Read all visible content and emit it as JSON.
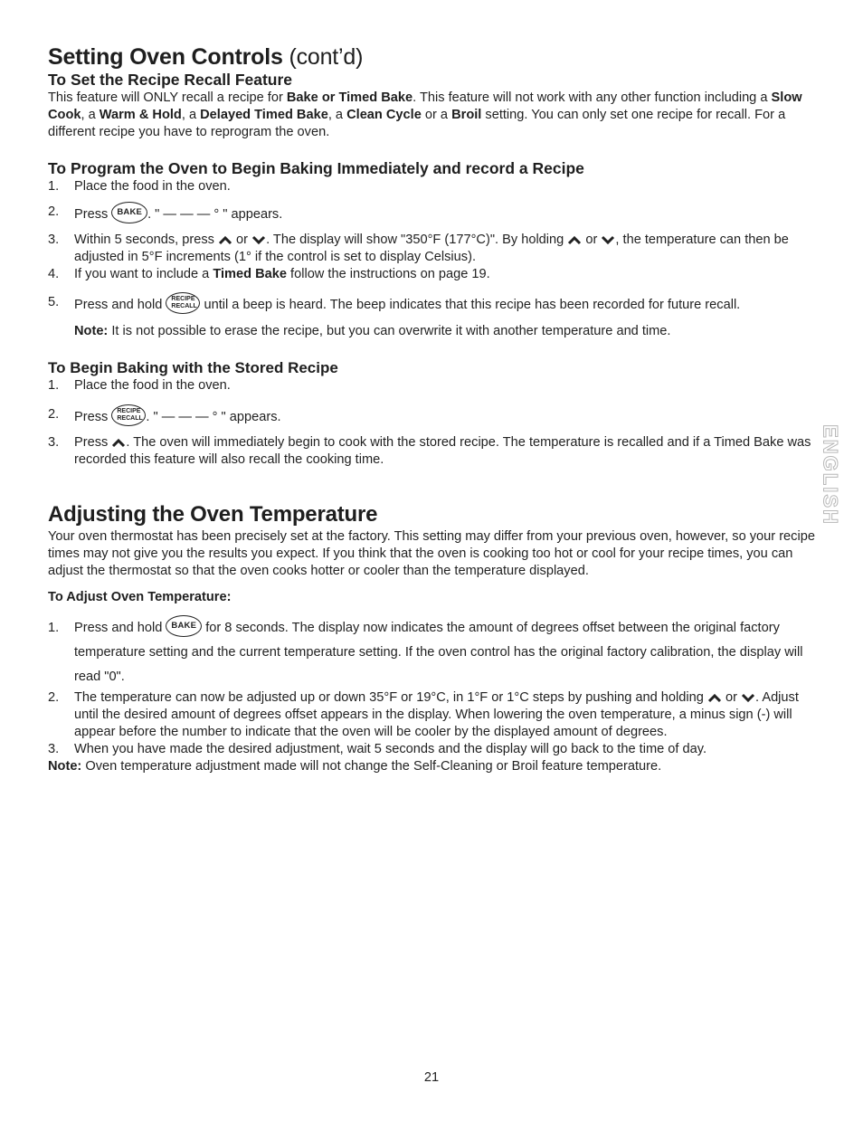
{
  "header": {
    "title_bold": "Setting Oven Controls",
    "title_light": "(cont’d)"
  },
  "recall_section": {
    "heading": "To Set the Recipe Recall Feature",
    "para": [
      "This feature will ONLY recall a recipe for ",
      "Bake or Timed Bake",
      ". This feature will not work with any other function including a ",
      "Slow Cook",
      ", a ",
      "Warm & Hold",
      ", a ",
      "Delayed Timed Bake",
      ", a ",
      "Clean Cycle",
      " or a ",
      "Broil",
      " setting. You can only set one recipe for recall. For a different recipe you have to reprogram the oven."
    ]
  },
  "program_section": {
    "heading": "To Program the Oven to Begin Baking Immediately and record a Recipe",
    "steps": [
      {
        "n": "1.",
        "text": "Place the food in the oven."
      },
      {
        "n": "2.",
        "pre": "Press ",
        "post": ". \" — — — ° \" appears."
      },
      {
        "n": "3.",
        "a": "Within 5 seconds, press ",
        "b": " or ",
        "c": ". The display will show \"350°F (177°C)\". By holding ",
        "d": " or ",
        "e": ", the temperature can then be adjusted in 5°F increments (1° if the control is set to display Celsius)."
      },
      {
        "n": "4.",
        "pre": "If you want to include a ",
        "bold": "Timed Bake",
        "post": " follow the instructions on page 19."
      },
      {
        "n": "5.",
        "pre": "Press and hold ",
        "post": " until a beep is heard. The beep indicates that this recipe has been recorded for future recall."
      }
    ],
    "note_label": "Note:",
    "note_text": " It is not possible to erase the recipe, but you can overwrite it with another temperature and time."
  },
  "stored_section": {
    "heading": "To Begin Baking with the Stored Recipe",
    "steps": [
      {
        "n": "1.",
        "text": "Place the food in the oven."
      },
      {
        "n": "2.",
        "pre": "Press ",
        "post": ". \" — — — ° \" appears."
      },
      {
        "n": "3.",
        "pre": "Press ",
        "post": ". The oven will immediately begin to cook with the stored recipe. The temperature is recalled and if a Timed Bake was recorded this feature will also recall the cooking time."
      }
    ]
  },
  "adjust_section": {
    "heading": "Adjusting the Oven Temperature",
    "intro": "Your oven thermostat has been precisely set at the factory. This setting may differ from your previous oven, however, so your recipe times may not give you the results you expect. If you think that the oven is cooking too hot or cool for your recipe times, you can adjust the thermostat so that the oven cooks hotter or cooler than the temperature displayed.",
    "subheading": "To Adjust Oven Temperature:",
    "steps": [
      {
        "n": "1.",
        "pre": "Press and hold ",
        "post": " for 8 seconds. The display now indicates the amount of degrees offset between the original factory temperature setting and the current temperature setting. If the oven control has the original factory calibration, the display will read \"0\"."
      },
      {
        "n": "2.",
        "pre": "The temperature can now be adjusted up or down 35°F or 19°C, in 1°F or 1°C steps by pushing and holding ",
        "mid": " or ",
        "post": ". Adjust until the desired amount of degrees offset appears in the display. When lowering the oven temperature, a minus sign (-) will appear before the number to indicate that the oven will be cooler by the displayed amount of degrees."
      },
      {
        "n": "3.",
        "text": "When you have made the desired adjustment, wait 5 seconds and the display will go back to the time of day."
      }
    ],
    "note_label": "Note:",
    "note_text": " Oven temperature adjustment made will not change the Self-Cleaning or Broil feature temperature."
  },
  "keys": {
    "bake": "BAKE",
    "recall_line1": "RECIPE",
    "recall_line2": "RECALL"
  },
  "icons": {
    "up": "up-arrow-icon",
    "down": "down-arrow-icon"
  },
  "side_tab": "ENGLISH",
  "footer": {
    "page_number": "21"
  }
}
